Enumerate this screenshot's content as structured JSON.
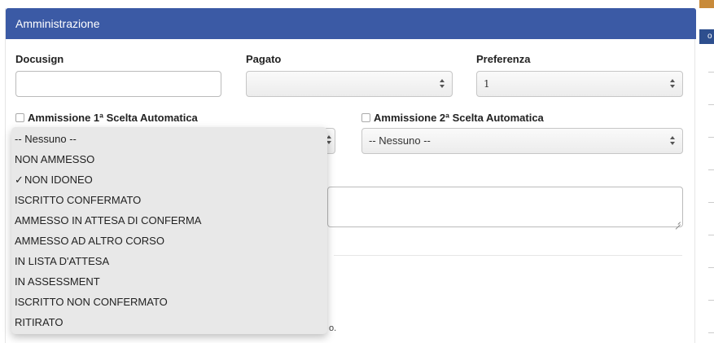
{
  "panel": {
    "title": "Amministrazione",
    "header_color": "#3b5aa5"
  },
  "fields": {
    "docusign": {
      "label": "Docusign",
      "value": ""
    },
    "pagato": {
      "label": "Pagato",
      "value": ""
    },
    "preferenza": {
      "label": "Preferenza",
      "value": "1"
    }
  },
  "ammissione1": {
    "label": "Ammissione 1ª Scelta Automatica",
    "checked": false
  },
  "ammissione2": {
    "label": "Ammissione 2ª Scelta Automatica",
    "checked": false,
    "select_value": "-- Nessuno --"
  },
  "dropdown": {
    "selected": "NON IDONEO",
    "options": [
      {
        "label": "-- Nessuno --",
        "check": ""
      },
      {
        "label": "NON AMMESSO",
        "check": ""
      },
      {
        "label": "NON IDONEO",
        "check": "✓"
      },
      {
        "label": "ISCRITTO CONFERMATO",
        "check": ""
      },
      {
        "label": "AMMESSO IN ATTESA DI CONFERMA",
        "check": ""
      },
      {
        "label": "AMMESSO AD ALTRO CORSO",
        "check": ""
      },
      {
        "label": "IN LISTA D'ATTESA",
        "check": ""
      },
      {
        "label": "IN ASSESSMENT",
        "check": ""
      },
      {
        "label": "ISCRITTO NON CONFERMATO",
        "check": ""
      },
      {
        "label": "RITIRATO",
        "check": ""
      }
    ]
  },
  "partial_text": "o.",
  "right_strip": {
    "letter": "o"
  }
}
